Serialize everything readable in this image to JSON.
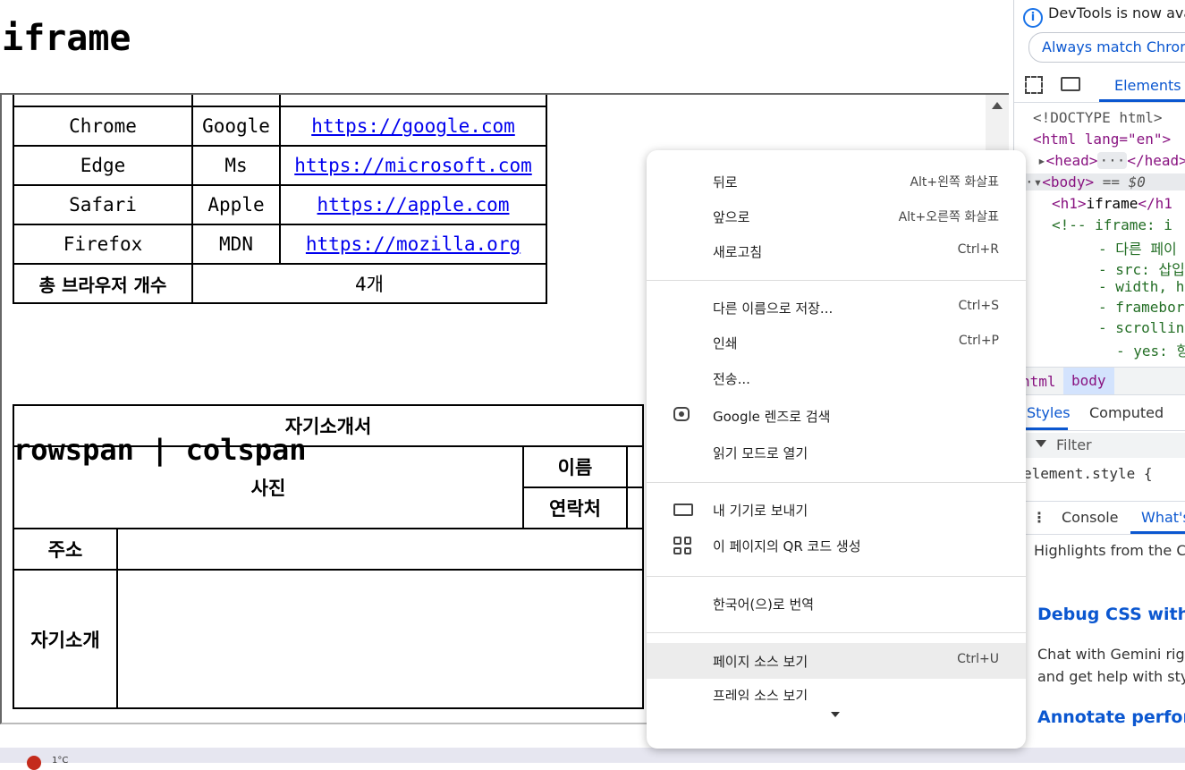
{
  "page": {
    "h1": "iframe",
    "browser_table": {
      "rows": [
        {
          "name": "Chrome",
          "vendor": "Google",
          "url": "https://google.com"
        },
        {
          "name": "Edge",
          "vendor": "Ms",
          "url": "https://microsoft.com"
        },
        {
          "name": "Safari",
          "vendor": "Apple",
          "url": "https://apple.com"
        },
        {
          "name": "Firefox",
          "vendor": "MDN",
          "url": "https://mozilla.org"
        }
      ],
      "total_label": "총 브라우저 개수",
      "total_value": "4개"
    },
    "h2": "rowspan | colspan",
    "intro_table": {
      "title": "자기소개서",
      "photo": "사진",
      "name": "이름",
      "contact": "연락처",
      "address": "주소",
      "intro": "자기소개"
    }
  },
  "devtools": {
    "info": "DevTools is now ava",
    "match_button": "Always match Chrom",
    "tab_elements": "Elements",
    "dom": {
      "doctype": "<!DOCTYPE html>",
      "html_open": "<html lang=\"en\">",
      "head": "<head>",
      "head_ellipsis": "···",
      "head_close": "</head>",
      "body": "<body>",
      "body_eq": "== $0",
      "h1_open": "<h1>",
      "h1_text": "iframe",
      "h1_close": "</h1",
      "comment": "<!-- iframe: i",
      "c1": "- 다른 페이",
      "c2": "- src: 삽입",
      "c3": "- width, h",
      "c4": "- framebor",
      "c5": "- scrollin",
      "c6": "- yes: 항"
    },
    "crumbs": {
      "html": "html",
      "body": "body"
    },
    "styles_tab": "Styles",
    "computed_tab": "Computed",
    "filter_placeholder": "Filter",
    "element_style": "element.style {",
    "drawer": {
      "console": "Console",
      "whats_new": "What's"
    },
    "highlights": "Highlights from the Ch",
    "debug_css": "Debug CSS with G",
    "chat_line1": "Chat with Gemini righ",
    "chat_line2": "and get help with styl",
    "annotate": "Annotate perform"
  },
  "context_menu": {
    "items": [
      {
        "label": "뒤로",
        "shortcut": "Alt+왼쪽 화살표"
      },
      {
        "label": "앞으로",
        "shortcut": "Alt+오른쪽 화살표"
      },
      {
        "label": "새로고침",
        "shortcut": "Ctrl+R"
      },
      {
        "label": "다른 이름으로 저장...",
        "shortcut": "Ctrl+S"
      },
      {
        "label": "인쇄",
        "shortcut": "Ctrl+P"
      },
      {
        "label": "전송...",
        "shortcut": ""
      },
      {
        "label": "Google 렌즈로 검색",
        "shortcut": "",
        "icon": "lens-icon"
      },
      {
        "label": "읽기 모드로 열기",
        "shortcut": ""
      },
      {
        "label": "내 기기로 보내기",
        "shortcut": "",
        "icon": "devices-icon"
      },
      {
        "label": "이 페이지의 QR 코드 생성",
        "shortcut": "",
        "icon": "qr-code-icon"
      },
      {
        "label": "한국어(으)로 번역",
        "shortcut": ""
      },
      {
        "label": "페이지 소스 보기",
        "shortcut": "Ctrl+U"
      },
      {
        "label": "프레임 소스 보기",
        "shortcut": ""
      }
    ]
  },
  "taskbar": {
    "temp": "1°C"
  }
}
